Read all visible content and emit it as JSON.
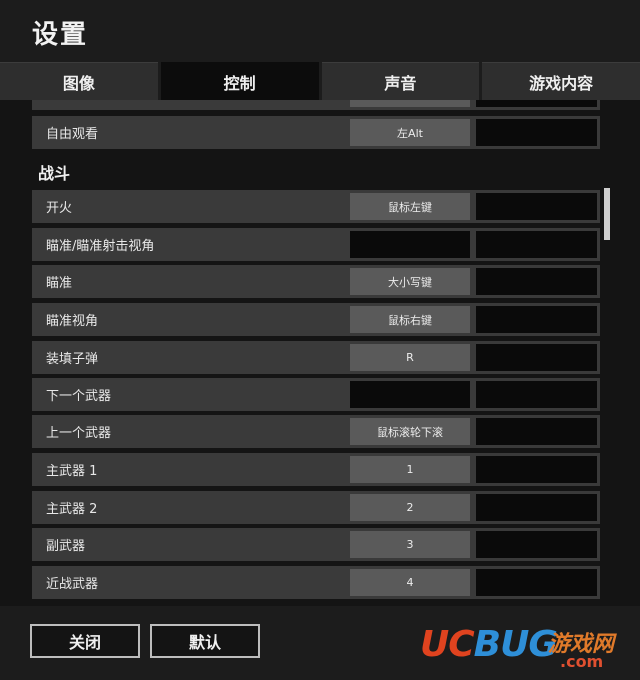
{
  "title": "设置",
  "tabs": [
    {
      "label": "图像",
      "active": false
    },
    {
      "label": "控制",
      "active": true
    },
    {
      "label": "声音",
      "active": false
    },
    {
      "label": "游戏内容",
      "active": false
    }
  ],
  "pre_rows": [
    {
      "label": "自由观看",
      "key": "左Alt"
    }
  ],
  "section": "战斗",
  "rows": [
    {
      "label": "开火",
      "key": "鼠标左键"
    },
    {
      "label": "瞄准/瞄准射击视角",
      "key": ""
    },
    {
      "label": "瞄准",
      "key": "大小写键"
    },
    {
      "label": "瞄准视角",
      "key": "鼠标右键"
    },
    {
      "label": "装填子弹",
      "key": "R"
    },
    {
      "label": "下一个武器",
      "key": ""
    },
    {
      "label": "上一个武器",
      "key": "鼠标滚轮下滚"
    },
    {
      "label": "主武器 1",
      "key": "1"
    },
    {
      "label": "主武器 2",
      "key": "2"
    },
    {
      "label": "副武器",
      "key": "3"
    },
    {
      "label": "近战武器",
      "key": "4"
    }
  ],
  "footer": {
    "close_label": "关闭",
    "default_label": "默认"
  },
  "watermark": {
    "logo_uc": "UC",
    "logo_bug": "BUG",
    "cn": "游戏网",
    "domain": ".com"
  }
}
